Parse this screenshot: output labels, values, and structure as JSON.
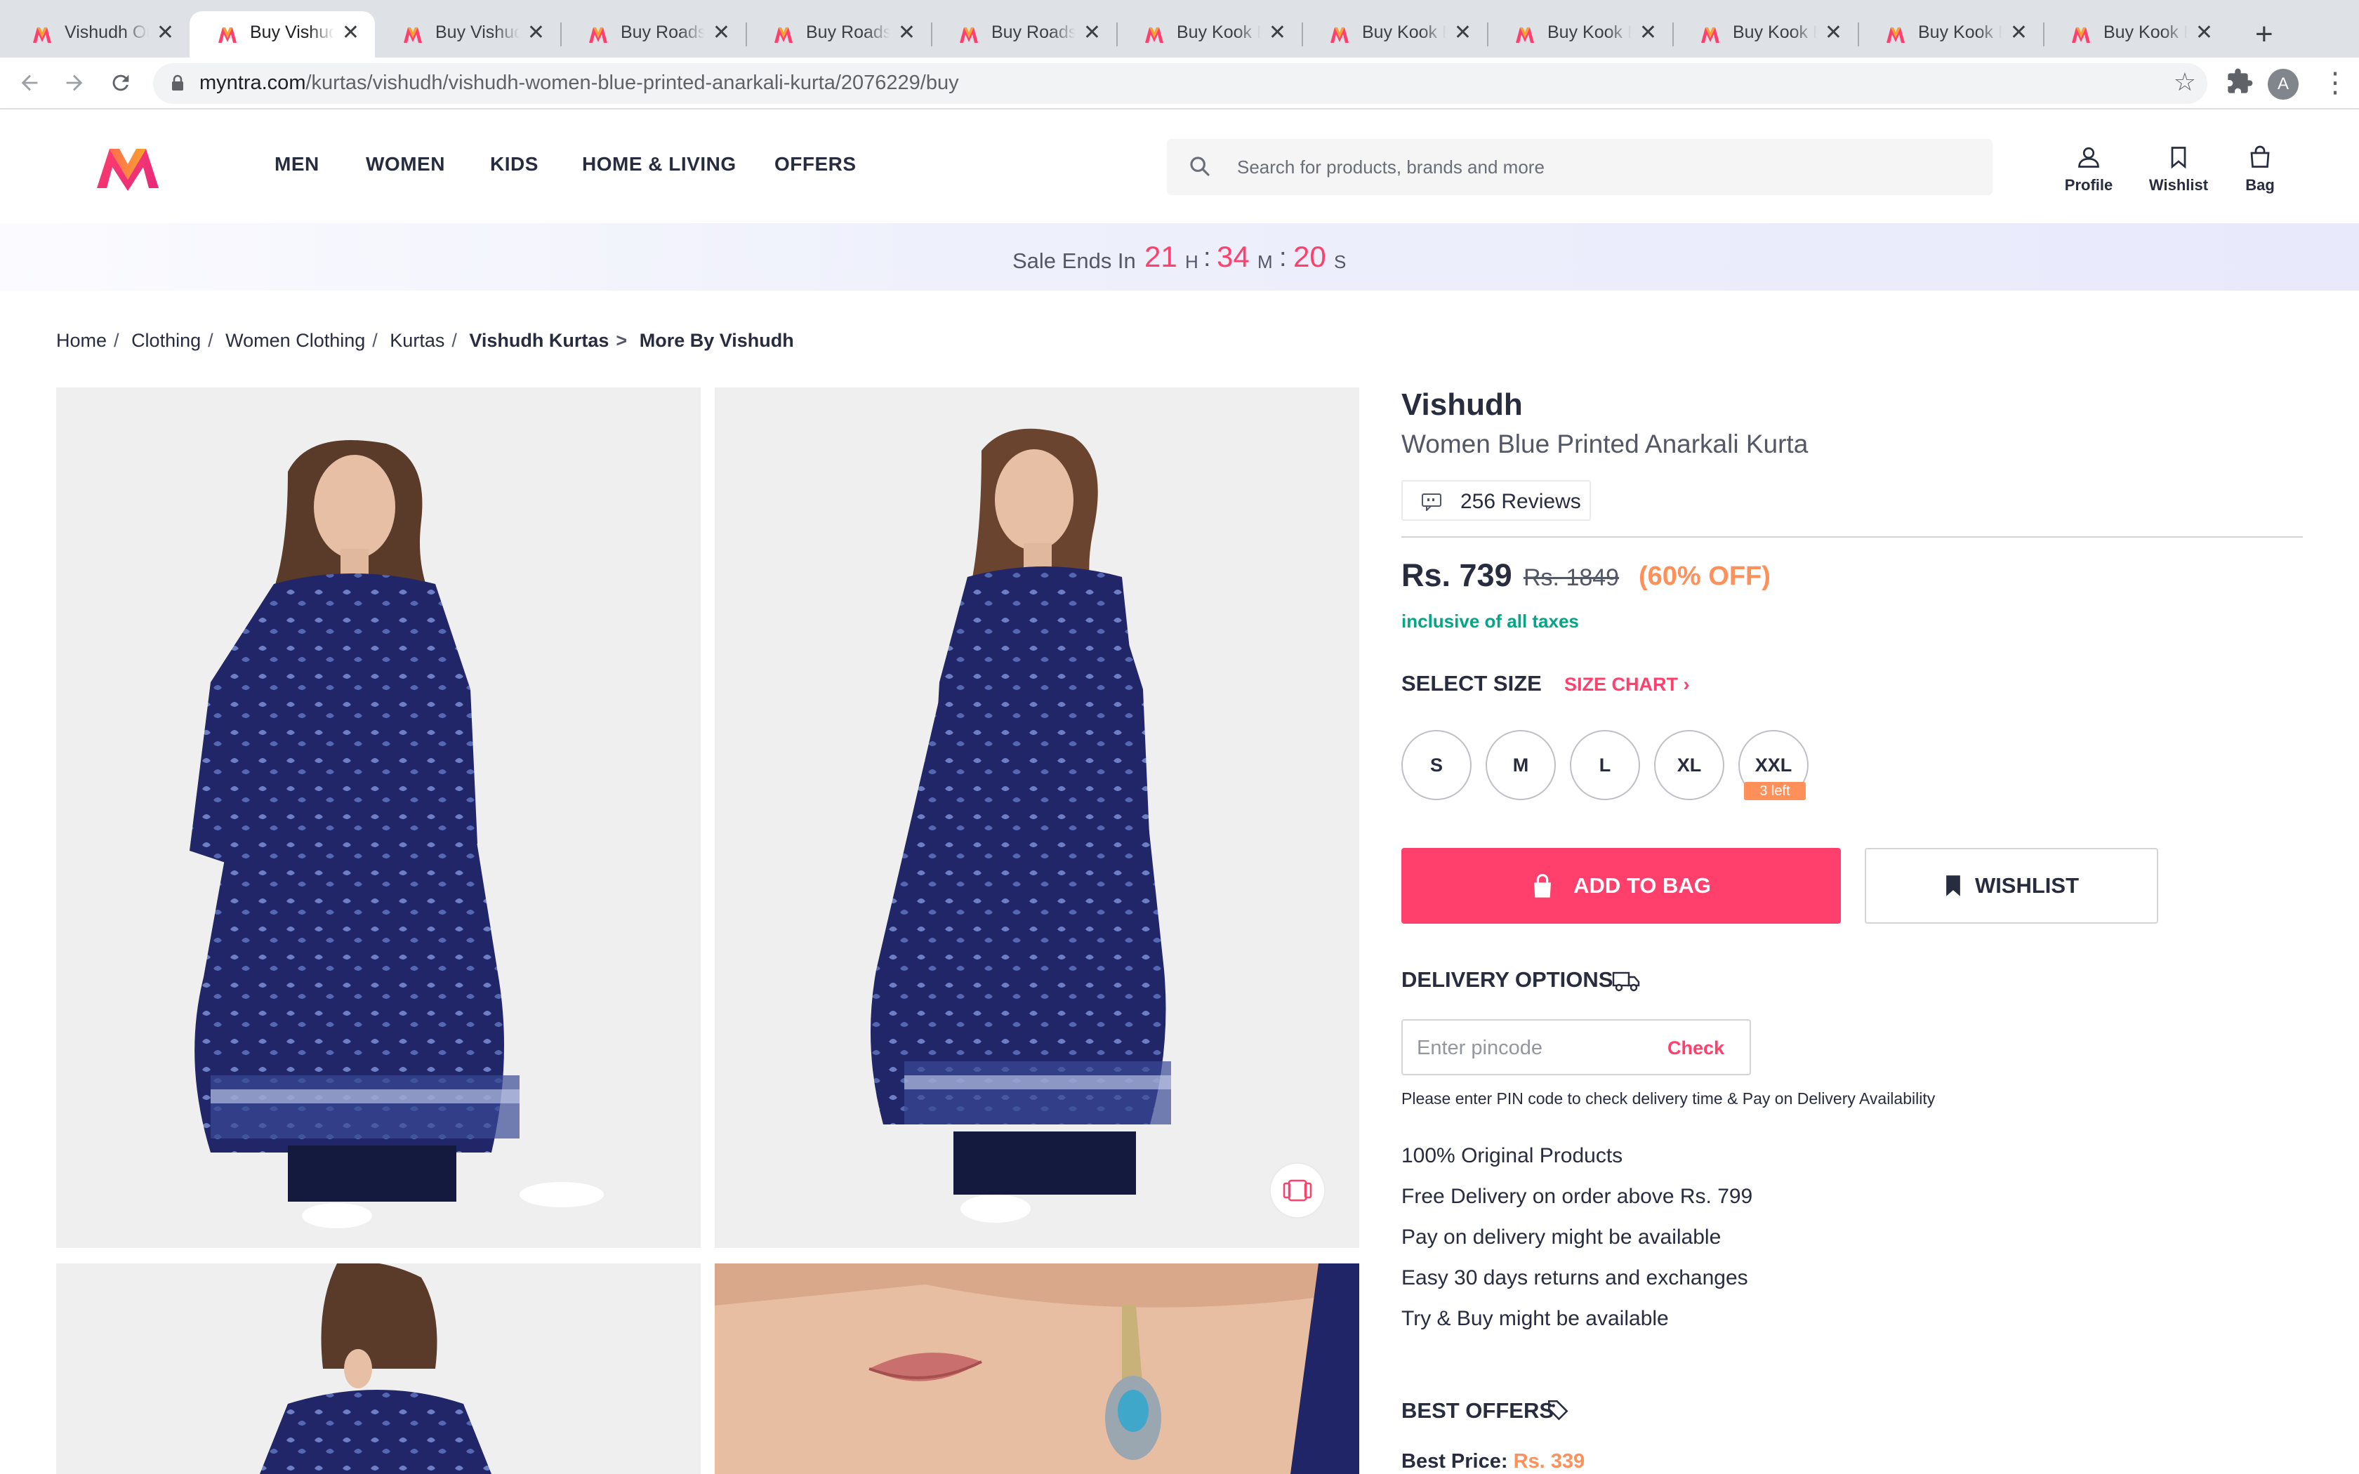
{
  "browser": {
    "tabs": [
      {
        "title": "Vishudh Online"
      },
      {
        "title": "Buy Vishudh Women"
      },
      {
        "title": "Buy Vishudh Women"
      },
      {
        "title": "Buy Roadster"
      },
      {
        "title": "Buy Roadster"
      },
      {
        "title": "Buy Roadster"
      },
      {
        "title": "Buy Kook N Keech"
      },
      {
        "title": "Buy Kook N Keech"
      },
      {
        "title": "Buy Kook N Keech"
      },
      {
        "title": "Buy Kook N Keech"
      },
      {
        "title": "Buy Kook N Keech"
      },
      {
        "title": "Buy Kook N Keech"
      }
    ],
    "active_tab_index": 1,
    "close_glyph": "✕",
    "new_tab_glyph": "+",
    "url_host": "myntra.com",
    "url_path": "/kurtas/vishudh/vishudh-women-blue-printed-anarkali-kurta/2076229/buy",
    "profile_initial": "A"
  },
  "header": {
    "nav": [
      "MEN",
      "WOMEN",
      "KIDS",
      "HOME & LIVING",
      "OFFERS"
    ],
    "search_placeholder": "Search for products, brands and more",
    "actions": {
      "profile": "Profile",
      "wishlist": "Wishlist",
      "bag": "Bag"
    }
  },
  "sale": {
    "label": "Sale Ends In",
    "hours": "21",
    "hours_unit": "H",
    "minutes": "34",
    "minutes_unit": "M",
    "seconds": "20",
    "seconds_unit": "S"
  },
  "breadcrumb": [
    {
      "label": "Home"
    },
    {
      "label": "Clothing"
    },
    {
      "label": "Women Clothing"
    },
    {
      "label": "Kurtas"
    },
    {
      "label": "Vishudh Kurtas"
    },
    {
      "label": "More By Vishudh"
    }
  ],
  "product": {
    "brand": "Vishudh",
    "name": "Women Blue Printed Anarkali Kurta",
    "reviews": "256 Reviews",
    "price": "Rs. 739",
    "mrp": "Rs. 1849",
    "discount": "(60% OFF)",
    "tax_note": "inclusive of all taxes",
    "select_size": "SELECT SIZE",
    "size_chart": "SIZE CHART",
    "size_chart_arrow": "›",
    "sizes": [
      "S",
      "M",
      "L",
      "XL",
      "XXL"
    ],
    "size_stock_note": "3 left",
    "add_to_bag": "ADD TO BAG",
    "wishlist": "WISHLIST"
  },
  "delivery": {
    "title": "DELIVERY OPTIONS",
    "pincode_placeholder": "Enter pincode",
    "check": "Check",
    "help": "Please enter PIN code to check delivery time & Pay on Delivery Availability",
    "features": [
      "100% Original Products",
      "Free Delivery on order above Rs. 799",
      "Pay on delivery might be available",
      "Easy 30 days returns and exchanges",
      "Try & Buy might be available"
    ]
  },
  "offers": {
    "title": "BEST OFFERS",
    "best_price_label": "Best Price:",
    "best_price_value": "Rs. 339"
  },
  "colors": {
    "accent": "#ff3f6c",
    "discount": "#ff905a",
    "tax_green": "#03a685",
    "kurta_navy": "#1f2566"
  }
}
